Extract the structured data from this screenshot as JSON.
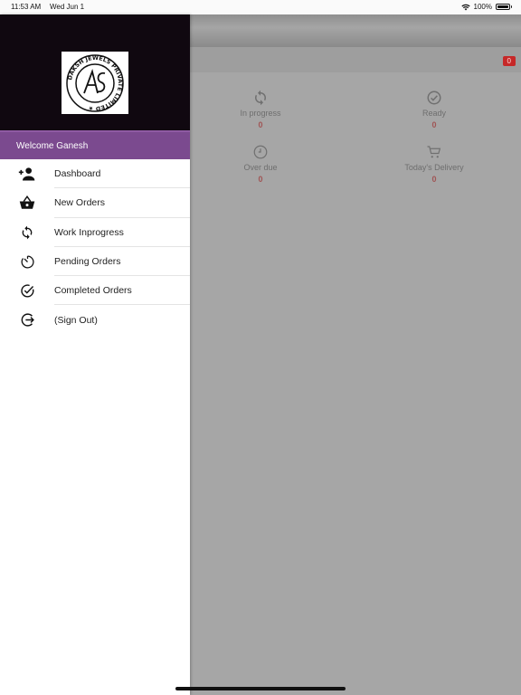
{
  "status_bar": {
    "time": "11:53 AM",
    "date": "Wed Jun 1",
    "battery": "100%"
  },
  "app": {
    "cart_count": "0",
    "tiles": [
      {
        "label": "In progress",
        "count": "0",
        "icon": "sync-icon"
      },
      {
        "label": "Ready",
        "count": "0",
        "icon": "check-circle-icon"
      },
      {
        "label": "Over due",
        "count": "0",
        "icon": "clock-icon"
      },
      {
        "label": "Today's Delivery",
        "count": "0",
        "icon": "cart-icon"
      }
    ]
  },
  "drawer": {
    "logo_text": "DAKSH JEWELS PRIVATE LIMITED",
    "welcome": "Welcome Ganesh",
    "items": [
      {
        "label": "Dashboard",
        "icon": "person-add-icon"
      },
      {
        "label": "New Orders",
        "icon": "basket-icon"
      },
      {
        "label": "Work Inprogress",
        "icon": "sync-icon"
      },
      {
        "label": "Pending Orders",
        "icon": "timer-icon"
      },
      {
        "label": "Completed Orders",
        "icon": "check-circle-icon"
      },
      {
        "label": "(Sign Out)",
        "icon": "logout-icon"
      }
    ]
  },
  "colors": {
    "welcome_bg": "#7b4a8f",
    "header_bg": "#100810",
    "badge": "#c62828"
  }
}
